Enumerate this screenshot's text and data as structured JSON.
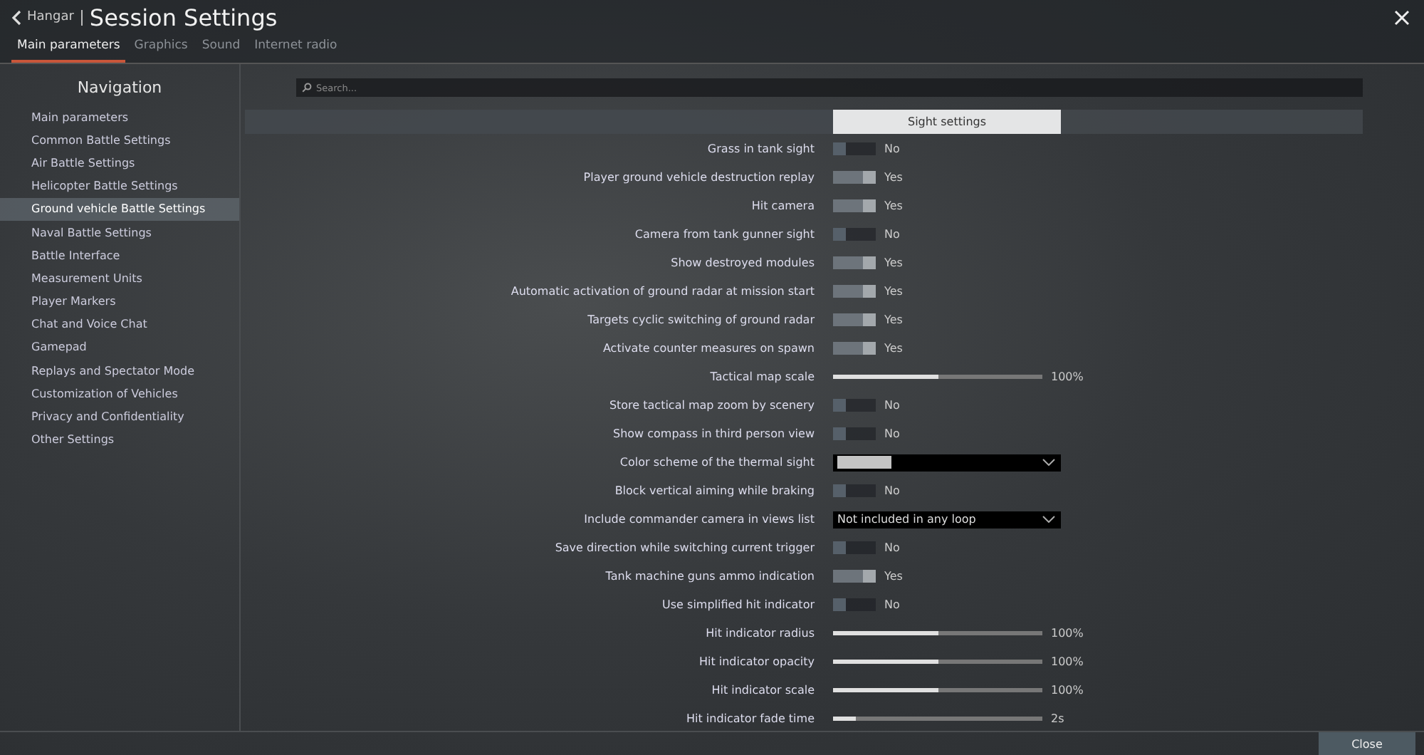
{
  "header": {
    "back": "Hangar",
    "title": "Session Settings"
  },
  "tabs": [
    {
      "label": "Main parameters",
      "selected": true
    },
    {
      "label": "Graphics",
      "selected": false
    },
    {
      "label": "Sound",
      "selected": false
    },
    {
      "label": "Internet radio",
      "selected": false
    }
  ],
  "navigation": {
    "title": "Navigation",
    "items": [
      {
        "label": "Main parameters",
        "selected": false
      },
      {
        "label": "Common Battle Settings",
        "selected": false
      },
      {
        "label": "Air Battle Settings",
        "selected": false
      },
      {
        "label": "Helicopter Battle Settings",
        "selected": false
      },
      {
        "label": "Ground vehicle Battle Settings",
        "selected": true
      },
      {
        "label": "Naval Battle Settings",
        "selected": false
      },
      {
        "label": "Battle Interface",
        "selected": false
      },
      {
        "label": "Measurement Units",
        "selected": false
      },
      {
        "label": "Player Markers",
        "selected": false
      },
      {
        "label": "Chat and Voice Chat",
        "selected": false
      },
      {
        "label": "Gamepad",
        "selected": false
      },
      {
        "label": "Replays and Spectator Mode",
        "selected": false
      },
      {
        "label": "Customization of Vehicles",
        "selected": false
      },
      {
        "label": "Privacy and Confidentiality",
        "selected": false
      },
      {
        "label": "Other Settings",
        "selected": false
      }
    ]
  },
  "search": {
    "placeholder": "Search..."
  },
  "section": "Sight settings",
  "settings": [
    {
      "kind": "toggle",
      "label": "Grass in tank sight",
      "on": false,
      "value": "No"
    },
    {
      "kind": "toggle",
      "label": "Player ground vehicle destruction replay",
      "on": true,
      "value": "Yes"
    },
    {
      "kind": "toggle",
      "label": "Hit camera",
      "on": true,
      "value": "Yes"
    },
    {
      "kind": "toggle",
      "label": "Camera from tank gunner sight",
      "on": false,
      "value": "No"
    },
    {
      "kind": "toggle",
      "label": "Show destroyed modules",
      "on": true,
      "value": "Yes"
    },
    {
      "kind": "toggle",
      "label": "Automatic activation of ground radar at mission start",
      "on": true,
      "value": "Yes"
    },
    {
      "kind": "toggle",
      "label": "Targets cyclic switching of ground radar",
      "on": true,
      "value": "Yes"
    },
    {
      "kind": "toggle",
      "label": "Activate counter measures on spawn",
      "on": true,
      "value": "Yes"
    },
    {
      "kind": "slider",
      "label": "Tactical map scale",
      "level": 0.5,
      "value": "100%"
    },
    {
      "kind": "toggle",
      "label": "Store tactical map zoom by scenery",
      "on": false,
      "value": "No"
    },
    {
      "kind": "toggle",
      "label": "Show compass in third person view",
      "on": false,
      "value": "No"
    },
    {
      "kind": "swatch",
      "label": "Color scheme of the thermal sight"
    },
    {
      "kind": "toggle",
      "label": "Block vertical aiming while braking",
      "on": false,
      "value": "No"
    },
    {
      "kind": "select",
      "label": "Include commander camera in views list",
      "value": "Not included in any loop"
    },
    {
      "kind": "toggle",
      "label": "Save direction while switching current trigger",
      "on": false,
      "value": "No"
    },
    {
      "kind": "toggle",
      "label": "Tank machine guns ammo indication",
      "on": true,
      "value": "Yes"
    },
    {
      "kind": "toggle",
      "label": "Use simplified hit indicator",
      "on": false,
      "value": "No"
    },
    {
      "kind": "slider",
      "label": "Hit indicator radius",
      "level": 0.5,
      "value": "100%"
    },
    {
      "kind": "slider",
      "label": "Hit indicator opacity",
      "level": 0.5,
      "value": "100%"
    },
    {
      "kind": "slider",
      "label": "Hit indicator scale",
      "level": 0.5,
      "value": "100%"
    },
    {
      "kind": "slider",
      "label": "Hit indicator fade time",
      "level": 0.11,
      "value": "2s"
    }
  ],
  "close": "Close"
}
